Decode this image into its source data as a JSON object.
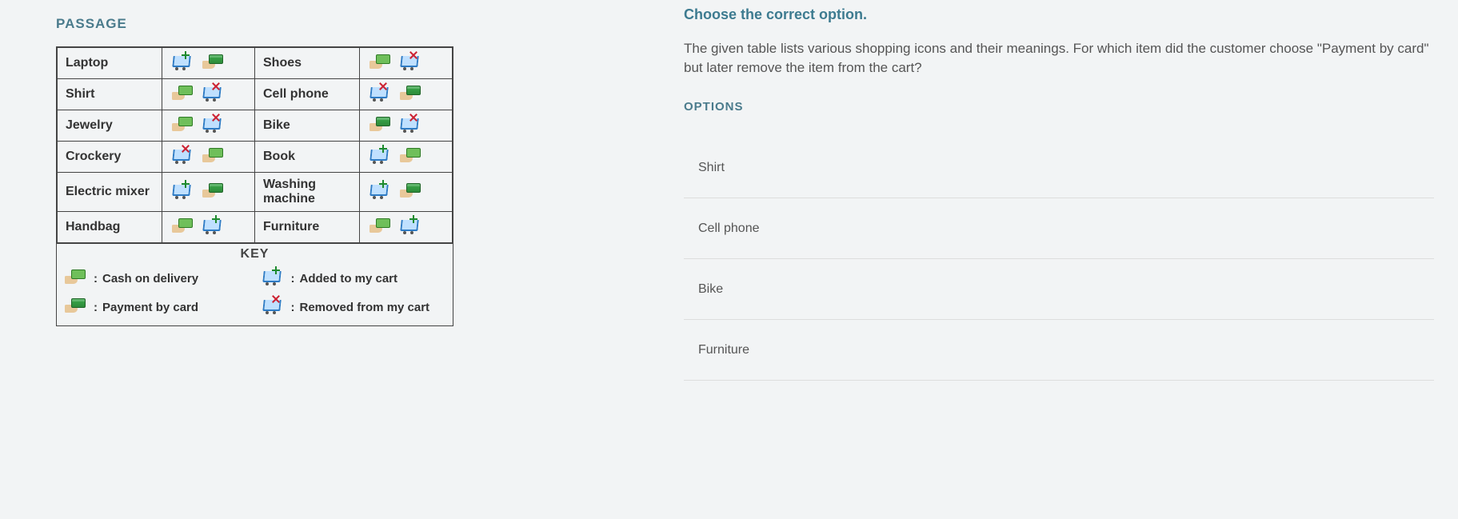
{
  "passage_label": "PASSAGE",
  "key_label": "KEY",
  "table": {
    "left": [
      {
        "name": "Laptop",
        "icons": [
          "cart-add",
          "pay-card"
        ]
      },
      {
        "name": "Shirt",
        "icons": [
          "pay-cash",
          "cart-remove"
        ]
      },
      {
        "name": "Jewelry",
        "icons": [
          "pay-cash",
          "cart-remove"
        ]
      },
      {
        "name": "Crockery",
        "icons": [
          "cart-remove",
          "pay-cash"
        ]
      },
      {
        "name": "Electric mixer",
        "icons": [
          "cart-add",
          "pay-card"
        ]
      },
      {
        "name": "Handbag",
        "icons": [
          "pay-cash",
          "cart-add"
        ]
      }
    ],
    "right": [
      {
        "name": "Shoes",
        "icons": [
          "pay-cash",
          "cart-remove"
        ]
      },
      {
        "name": "Cell phone",
        "icons": [
          "cart-remove",
          "pay-card"
        ]
      },
      {
        "name": "Bike",
        "icons": [
          "pay-card",
          "cart-remove"
        ]
      },
      {
        "name": "Book",
        "icons": [
          "cart-add",
          "pay-cash"
        ]
      },
      {
        "name": "Washing machine",
        "icons": [
          "cart-add",
          "pay-card"
        ]
      },
      {
        "name": "Furniture",
        "icons": [
          "pay-cash",
          "cart-add"
        ]
      }
    ]
  },
  "key": {
    "cash": "Cash on delivery",
    "add": "Added to my cart",
    "card": "Payment by card",
    "remove": "Removed from my cart"
  },
  "question": {
    "heading": "Choose the correct option.",
    "text": "The given table lists various shopping icons and their meanings. For which item did the customer choose \"Payment by card\" but later remove the item from the cart?",
    "options_label": "OPTIONS",
    "options": [
      "Shirt",
      "Cell phone",
      "Bike",
      "Furniture"
    ]
  }
}
